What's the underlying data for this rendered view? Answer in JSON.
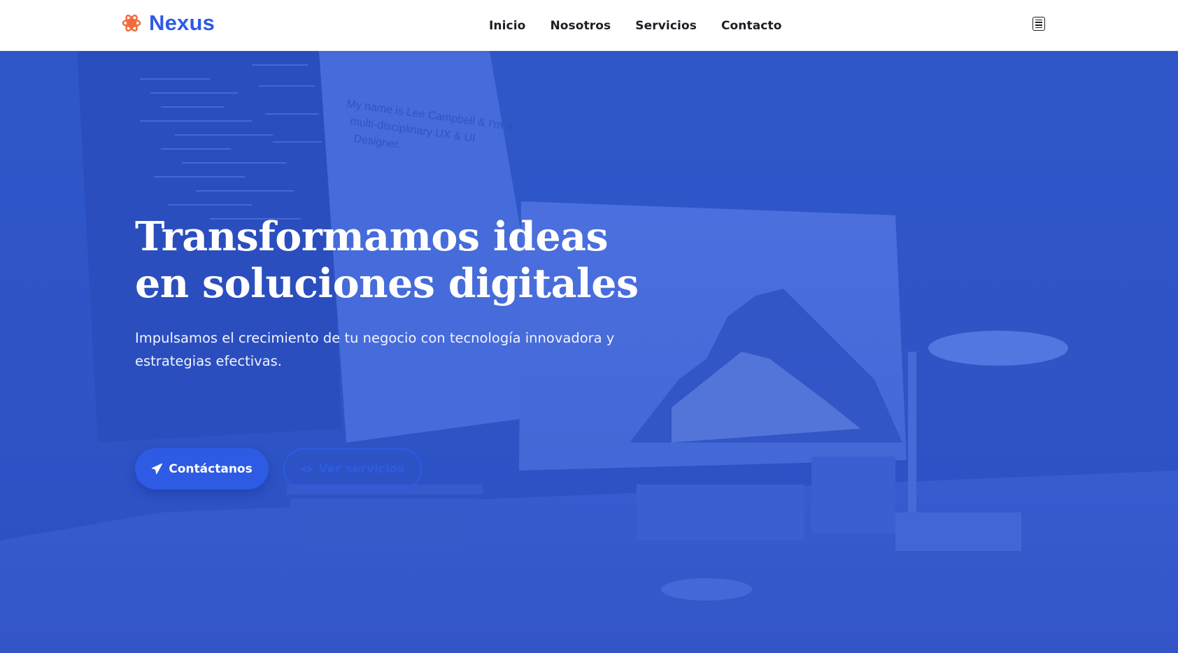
{
  "brand": {
    "name": "Nexus",
    "logo_icon": "atom-icon",
    "accent": "#2d5be3",
    "logo_color": "#f26b3a"
  },
  "nav": {
    "links": [
      "Inicio",
      "Nosotros",
      "Servicios",
      "Contacto"
    ],
    "menu_icon": "hamburger-menu-icon"
  },
  "hero": {
    "title": "Transformamos ideas en soluciones digitales",
    "subtitle": "Impulsamos el crecimiento de tu negocio con tecnología innovadora y estrategias efectivas.",
    "primary_button": {
      "label": "Contáctanos",
      "icon": "paper-plane-icon"
    },
    "secondary_button": {
      "label": "Ver servicios",
      "icon": "eye-icon"
    },
    "overlay_color": "#2f55c8",
    "background_screen_text": "My name is Lee Campbell & I'm a multi-disciplinary UX & UI Designer."
  }
}
